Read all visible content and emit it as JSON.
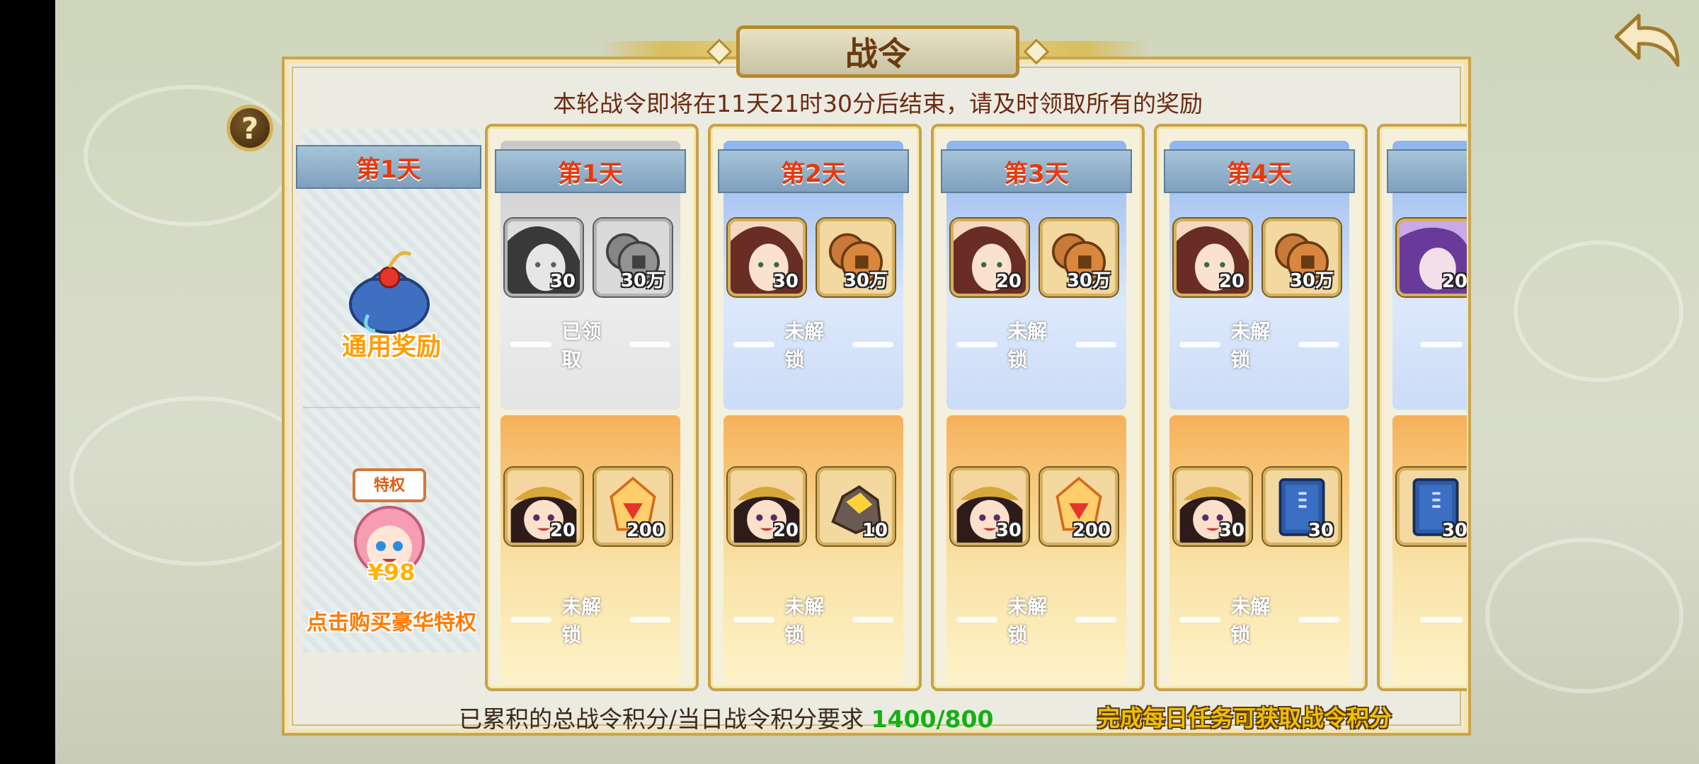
{
  "title": "战令",
  "countdown": "本轮战令即将在11天21时30分后结束，请及时领取所有的奖励",
  "help_label": "?",
  "left_column": {
    "day_header": "第1天",
    "general_label": "通用奖励",
    "premium_price": "¥98",
    "premium_label": "点击购买豪华特权",
    "premium_badge": "特权"
  },
  "days": [
    {
      "header": "第1天",
      "free": {
        "items": [
          {
            "icon": "girl-portrait-icon",
            "qty": "30"
          },
          {
            "icon": "coin-icon",
            "qty": "30万"
          }
        ],
        "status": "已领取"
      },
      "premium": {
        "items": [
          {
            "icon": "boy-portrait-icon",
            "qty": "20"
          },
          {
            "icon": "crystal-icon",
            "qty": "200"
          }
        ],
        "status": "未解锁"
      }
    },
    {
      "header": "第2天",
      "free": {
        "items": [
          {
            "icon": "girl-portrait-icon",
            "qty": "30"
          },
          {
            "icon": "coin-icon",
            "qty": "30万"
          }
        ],
        "status": "未解锁"
      },
      "premium": {
        "items": [
          {
            "icon": "boy-portrait-icon",
            "qty": "20"
          },
          {
            "icon": "gold-ore-icon",
            "qty": "10"
          }
        ],
        "status": "未解锁"
      }
    },
    {
      "header": "第3天",
      "free": {
        "items": [
          {
            "icon": "girl-portrait-icon",
            "qty": "20"
          },
          {
            "icon": "coin-icon",
            "qty": "30万"
          }
        ],
        "status": "未解锁"
      },
      "premium": {
        "items": [
          {
            "icon": "boy-portrait-icon",
            "qty": "30"
          },
          {
            "icon": "crystal-icon",
            "qty": "200"
          }
        ],
        "status": "未解锁"
      }
    },
    {
      "header": "第4天",
      "free": {
        "items": [
          {
            "icon": "girl-portrait-icon",
            "qty": "20"
          },
          {
            "icon": "coin-icon",
            "qty": "30万"
          }
        ],
        "status": "未解锁"
      },
      "premium": {
        "items": [
          {
            "icon": "boy-portrait-icon",
            "qty": "30"
          },
          {
            "icon": "blue-book-icon",
            "qty": "30"
          }
        ],
        "status": "未解锁"
      }
    },
    {
      "header": "第",
      "free": {
        "items": [
          {
            "icon": "purple-girl-portrait-icon",
            "qty": "20"
          }
        ],
        "status": "未"
      },
      "premium": {
        "items": [
          {
            "icon": "blue-book-icon",
            "qty": "30"
          }
        ],
        "status": "未"
      }
    }
  ],
  "footer": {
    "points_label": "已累积的总战令积分/当日战令积分要求",
    "points_value": "1400/800",
    "hint": "完成每日任务可获取战令积分"
  },
  "colors": {
    "day_header_text": "#e8380e",
    "points_value": "#14b014",
    "hint": "#f0c000",
    "frame_gold": "#c8a24a"
  }
}
